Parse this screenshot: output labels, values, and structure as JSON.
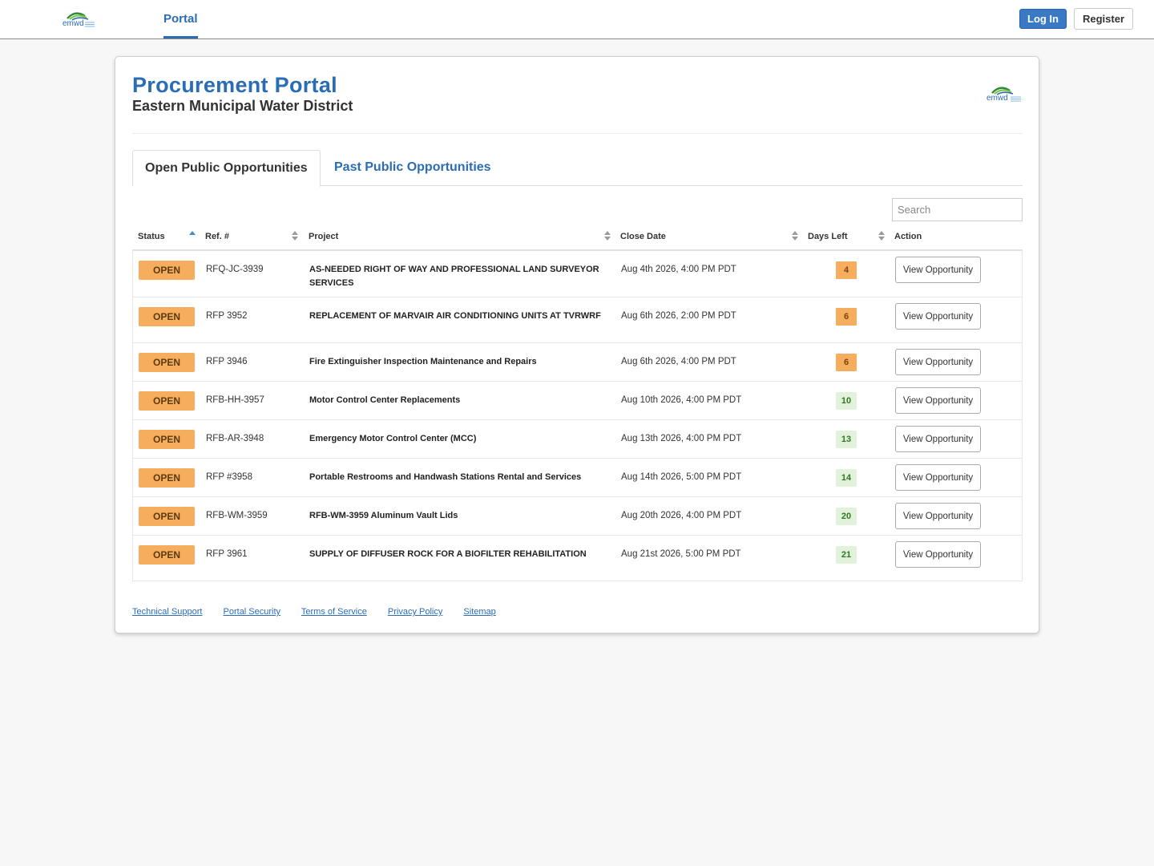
{
  "nav": {
    "brand": "emwd",
    "portal_label": "Portal",
    "login_label": "Log In",
    "register_label": "Register"
  },
  "header": {
    "title": "Procurement Portal",
    "subtitle": "Eastern Municipal Water District"
  },
  "tabs": {
    "open_label": "Open Public Opportunities",
    "past_label": "Past Public Opportunities"
  },
  "search": {
    "placeholder": "Search"
  },
  "table": {
    "columns": [
      "Status",
      "Ref. #",
      "Project",
      "Close Date",
      "Days Left",
      "Action"
    ],
    "rows": [
      {
        "status": "OPEN",
        "ref": "RFQ-JC-3939",
        "project": "AS-NEEDED RIGHT OF WAY AND PROFESSIONAL LAND SURVEYOR SERVICES",
        "close_date": "Aug 4th 2026, 4:00 PM PDT",
        "days_left": "4",
        "action": "View Opportunity"
      },
      {
        "status": "OPEN",
        "ref": "RFP 3952",
        "project": "REPLACEMENT OF MARVAIR AIR CONDITIONING UNITS AT TVRWRF",
        "close_date": "Aug 6th 2026, 2:00 PM PDT",
        "days_left": "6",
        "action": "View Opportunity"
      },
      {
        "status": "OPEN",
        "ref": "RFP 3946",
        "project": "Fire Extinguisher Inspection Maintenance and Repairs",
        "close_date": "Aug 6th 2026, 4:00 PM PDT",
        "days_left": "6",
        "action": "View Opportunity"
      },
      {
        "status": "OPEN",
        "ref": "RFB-HH-3957",
        "project": "Motor Control Center Replacements",
        "close_date": "Aug 10th 2026, 4:00 PM PDT",
        "days_left": "10",
        "action": "View Opportunity"
      },
      {
        "status": "OPEN",
        "ref": "RFB-AR-3948",
        "project": "Emergency Motor Control Center (MCC)",
        "close_date": "Aug 13th 2026, 4:00 PM PDT",
        "days_left": "13",
        "action": "View Opportunity"
      },
      {
        "status": "OPEN",
        "ref": "RFP #3958",
        "project": "Portable Restrooms and Handwash Stations Rental and Services",
        "close_date": "Aug 14th 2026, 5:00 PM PDT",
        "days_left": "14",
        "action": "View Opportunity"
      },
      {
        "status": "OPEN",
        "ref": "RFB-WM-3959",
        "project": "RFB-WM-3959 Aluminum Vault Lids",
        "close_date": "Aug 20th 2026, 4:00 PM PDT",
        "days_left": "20",
        "action": "View Opportunity"
      },
      {
        "status": "OPEN",
        "ref": "RFP 3961",
        "project": "SUPPLY OF DIFFUSER ROCK FOR A BIOFILTER REHABILITATION",
        "close_date": "Aug 21st 2026, 5:00 PM PDT",
        "days_left": "21",
        "action": "View Opportunity"
      }
    ]
  },
  "footer": {
    "links": [
      "Technical Support",
      "Portal Security",
      "Terms of Service",
      "Privacy Policy",
      "Sitemap"
    ]
  },
  "colors": {
    "brand_blue": "#2a6db5",
    "open_badge": "#f7ad5e",
    "days_urgent": "#f7ad5e",
    "days_ok": "#e2f1dc"
  }
}
